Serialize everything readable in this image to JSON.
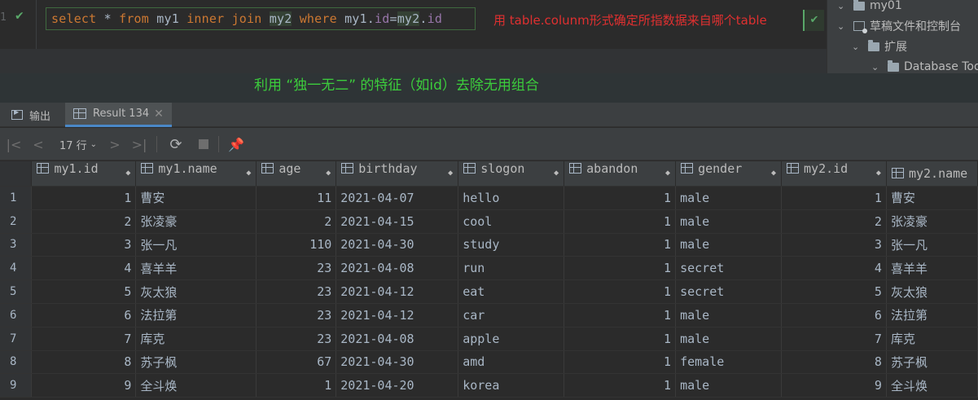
{
  "editor": {
    "line_number": "1",
    "query_tokens": [
      {
        "t": "select",
        "c": "kw"
      },
      {
        "t": " * ",
        "c": "id"
      },
      {
        "t": "from",
        "c": "kw"
      },
      {
        "t": " my1 ",
        "c": "id"
      },
      {
        "t": "inner",
        "c": "kw"
      },
      {
        "t": " ",
        "c": "id"
      },
      {
        "t": "join",
        "c": "kw"
      },
      {
        "t": " ",
        "c": "id"
      },
      {
        "t": "my2",
        "c": "hl"
      },
      {
        "t": " ",
        "c": "id"
      },
      {
        "t": "where",
        "c": "kw"
      },
      {
        "t": " my1.",
        "c": "id"
      },
      {
        "t": "id",
        "c": "fld"
      },
      {
        "t": "=",
        "c": "id"
      },
      {
        "t": "my2",
        "c": "hl"
      },
      {
        "t": ".",
        "c": "id"
      },
      {
        "t": "id",
        "c": "fld"
      }
    ],
    "annotation_red": "用 table.colunm形式确定所指数据来自哪个table"
  },
  "annotation_green": "利用 “独一无二” 的特征（如id）去除无用组合",
  "tree": {
    "items": [
      {
        "label": "my01",
        "chevron": "⌄",
        "icon": "folder"
      },
      {
        "label": "草稿文件和控制台",
        "chevron": "⌄",
        "icon": "console"
      },
      {
        "label": "扩展",
        "chevron": "⌄",
        "icon": "folder"
      },
      {
        "label": "Database Tools",
        "chevron": "⌄",
        "icon": "folder"
      }
    ]
  },
  "tabs": {
    "output_label": "输出",
    "result_label": "Result 134"
  },
  "toolbar": {
    "rows_label": "17 行"
  },
  "grid": {
    "columns": [
      "my1.id",
      "my1.name",
      "age",
      "birthday",
      "slogon",
      "abandon",
      "gender",
      "my2.id",
      "my2.name"
    ],
    "rows": [
      [
        "1",
        "1",
        "曹安",
        "11",
        "2021-04-07",
        "hello",
        "1",
        "male",
        "1",
        "曹安"
      ],
      [
        "2",
        "2",
        "张凌豪",
        "2",
        "2021-04-15",
        "cool",
        "1",
        "male",
        "2",
        "张凌豪"
      ],
      [
        "3",
        "3",
        "张一凡",
        "110",
        "2021-04-30",
        "study",
        "1",
        "male",
        "3",
        "张一凡"
      ],
      [
        "4",
        "4",
        "喜羊羊",
        "23",
        "2021-04-08",
        "run",
        "1",
        "secret",
        "4",
        "喜羊羊"
      ],
      [
        "5",
        "5",
        "灰太狼",
        "23",
        "2021-04-12",
        "eat",
        "1",
        "secret",
        "5",
        "灰太狼"
      ],
      [
        "6",
        "6",
        "法拉第",
        "23",
        "2021-04-12",
        "car",
        "1",
        "male",
        "6",
        "法拉第"
      ],
      [
        "7",
        "7",
        "库克",
        "23",
        "2021-04-08",
        "apple",
        "1",
        "male",
        "7",
        "库克"
      ],
      [
        "8",
        "8",
        "苏子枫",
        "67",
        "2021-04-30",
        "amd",
        "1",
        "female",
        "8",
        "苏子枫"
      ],
      [
        "9",
        "9",
        "全斗焕",
        "1",
        "2021-04-20",
        "korea",
        "1",
        "male",
        "9",
        "全斗焕"
      ]
    ]
  }
}
